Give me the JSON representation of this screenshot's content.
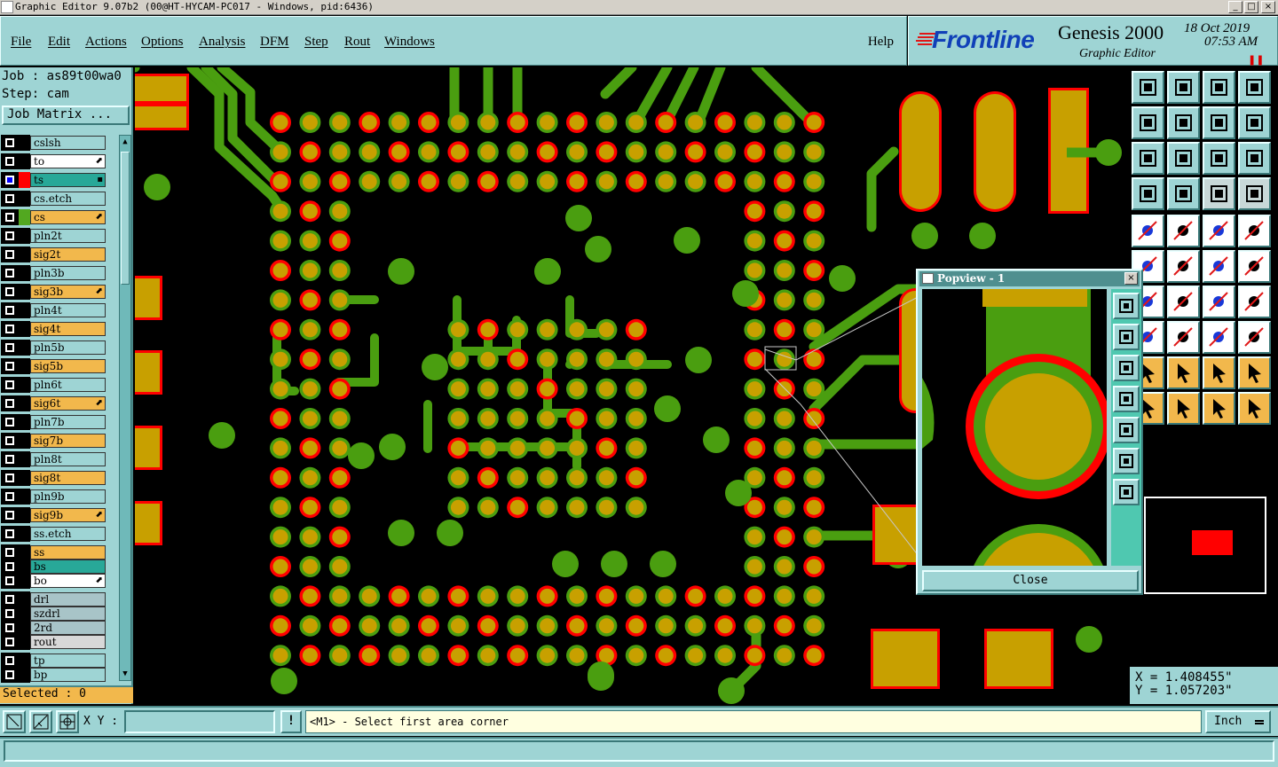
{
  "window": {
    "title": "Graphic Editor 9.07b2 (00@HT-HYCAM-PC017 - Windows, pid:6436)",
    "minimize": "_",
    "maximize": "□",
    "close": "×"
  },
  "menu": {
    "items": [
      "File",
      "Edit",
      "Actions",
      "Options",
      "Analysis",
      "DFM",
      "Step",
      "Rout",
      "Windows"
    ],
    "help": "Help"
  },
  "brand": {
    "logo": "Frontline",
    "product": "Genesis 2000",
    "module": "Graphic Editor",
    "date": "18 Oct 2019",
    "time": "07:53 AM",
    "pause_icon": "pause-icon"
  },
  "job": {
    "job_line": "Job : as89t00wa0",
    "step_line": "Step: cam",
    "matrix_button": "Job Matrix ..."
  },
  "layers": [
    {
      "name": "cslsh",
      "color": "#9ed4d4",
      "sel": "#000000",
      "aff": ""
    },
    {
      "name": "to",
      "color": "#ffffff",
      "sel": "#000000",
      "aff": "⬈"
    },
    {
      "name": "ts",
      "color": "#28a898",
      "sel": "#ff0000",
      "aff": "▪",
      "checked": true
    },
    {
      "name": "cs.etch",
      "color": "#9ed4d4",
      "sel": "#000000",
      "aff": ""
    },
    {
      "name": "cs",
      "color": "#f2b84c",
      "sel": "#52a820",
      "aff": "⬈"
    },
    {
      "name": "pln2t",
      "color": "#9ed4d4",
      "sel": "#000000",
      "aff": ""
    },
    {
      "name": "sig2t",
      "color": "#f2b84c",
      "sel": "#000000",
      "aff": ""
    },
    {
      "name": "pln3b",
      "color": "#9ed4d4",
      "sel": "#000000",
      "aff": ""
    },
    {
      "name": "sig3b",
      "color": "#f2b84c",
      "sel": "#000000",
      "aff": "⬈"
    },
    {
      "name": "pln4t",
      "color": "#9ed4d4",
      "sel": "#000000",
      "aff": ""
    },
    {
      "name": "sig4t",
      "color": "#f2b84c",
      "sel": "#000000",
      "aff": ""
    },
    {
      "name": "pln5b",
      "color": "#9ed4d4",
      "sel": "#000000",
      "aff": ""
    },
    {
      "name": "sig5b",
      "color": "#f2b84c",
      "sel": "#000000",
      "aff": ""
    },
    {
      "name": "pln6t",
      "color": "#9ed4d4",
      "sel": "#000000",
      "aff": ""
    },
    {
      "name": "sig6t",
      "color": "#f2b84c",
      "sel": "#000000",
      "aff": "⬈"
    },
    {
      "name": "pln7b",
      "color": "#9ed4d4",
      "sel": "#000000",
      "aff": ""
    },
    {
      "name": "sig7b",
      "color": "#f2b84c",
      "sel": "#000000",
      "aff": ""
    },
    {
      "name": "pln8t",
      "color": "#9ed4d4",
      "sel": "#000000",
      "aff": ""
    },
    {
      "name": "sig8t",
      "color": "#f2b84c",
      "sel": "#000000",
      "aff": ""
    },
    {
      "name": "pln9b",
      "color": "#9ed4d4",
      "sel": "#000000",
      "aff": ""
    },
    {
      "name": "sig9b",
      "color": "#f2b84c",
      "sel": "#000000",
      "aff": "⬈"
    },
    {
      "name": "ss.etch",
      "color": "#9ed4d4",
      "sel": "#000000",
      "aff": ""
    },
    {
      "name": "ss",
      "color": "#f2b84c",
      "sel": "#000000",
      "aff": "",
      "gap": true
    },
    {
      "name": "bs",
      "color": "#28a898",
      "sel": "#000000",
      "aff": "",
      "compact": true
    },
    {
      "name": "bo",
      "color": "#ffffff",
      "sel": "#000000",
      "aff": "⬈",
      "compact": true
    },
    {
      "name": "drl",
      "color": "#a8c4c8",
      "sel": "#000000",
      "aff": "",
      "gap": true
    },
    {
      "name": "szdrl",
      "color": "#a8c4c8",
      "sel": "#000000",
      "aff": "",
      "compact": true
    },
    {
      "name": "2rd",
      "color": "#a8c4c8",
      "sel": "#000000",
      "aff": "",
      "compact": true
    },
    {
      "name": "rout",
      "color": "#d8d8d8",
      "sel": "#000000",
      "aff": "",
      "compact": true
    },
    {
      "name": "tp",
      "color": "#9ed4d4",
      "sel": "#000000",
      "aff": "",
      "gap": true
    },
    {
      "name": "bp",
      "color": "#9ed4d4",
      "sel": "#000000",
      "aff": "",
      "compact": true
    }
  ],
  "selected": "Selected : 0",
  "popview": {
    "title": "Popview - 1",
    "close_label": "Close"
  },
  "coords": {
    "x": "X = 1.408455\"",
    "y": "Y = 1.057203\""
  },
  "status": {
    "xy_label": "X Y :",
    "xy_value": "",
    "warn_label": "!",
    "message": "<M1> - Select first area corner",
    "units": "Inch"
  },
  "colors": {
    "pad_ring": "#ff0000",
    "pad_fill": "#c8a000",
    "trace": "#4a9e10",
    "panel": "#9ed4d4"
  }
}
